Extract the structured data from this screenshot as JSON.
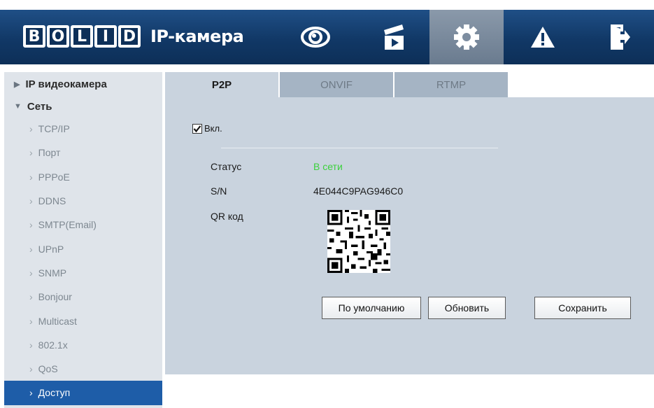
{
  "header": {
    "logo_letters": [
      "B",
      "O",
      "L",
      "I",
      "D"
    ],
    "logo_text": "IP-камера",
    "nav": [
      {
        "icon": "eye-icon",
        "name": "live"
      },
      {
        "icon": "clapperboard-icon",
        "name": "playback"
      },
      {
        "icon": "gear-icon",
        "name": "settings",
        "active": true
      },
      {
        "icon": "warning-icon",
        "name": "alarm"
      },
      {
        "icon": "logout-icon",
        "name": "logout"
      }
    ]
  },
  "sidebar": {
    "top_items": [
      "IP видеокамера",
      "Сеть"
    ],
    "items": [
      "TCP/IP",
      "Порт",
      "PPPoE",
      "DDNS",
      "SMTP(Email)",
      "UPnP",
      "SNMP",
      "Bonjour",
      "Multicast",
      "802.1x",
      "QoS",
      "Доступ"
    ],
    "active_item": "Доступ"
  },
  "tabs": [
    "P2P",
    "ONVIF",
    "RTMP"
  ],
  "active_tab": "P2P",
  "form": {
    "enable_label": "Вкл.",
    "enabled": true,
    "status_label": "Статус",
    "status_value": "В сети",
    "sn_label": "S/N",
    "sn_value": "4E044C9PAG946C0",
    "qr_label": "QR код"
  },
  "buttons": {
    "default": "По умолчанию",
    "refresh": "Обновить",
    "save": "Сохранить"
  },
  "colors": {
    "header": "#113866",
    "accent": "#1e5da8",
    "status_ok": "#3cd13c"
  }
}
